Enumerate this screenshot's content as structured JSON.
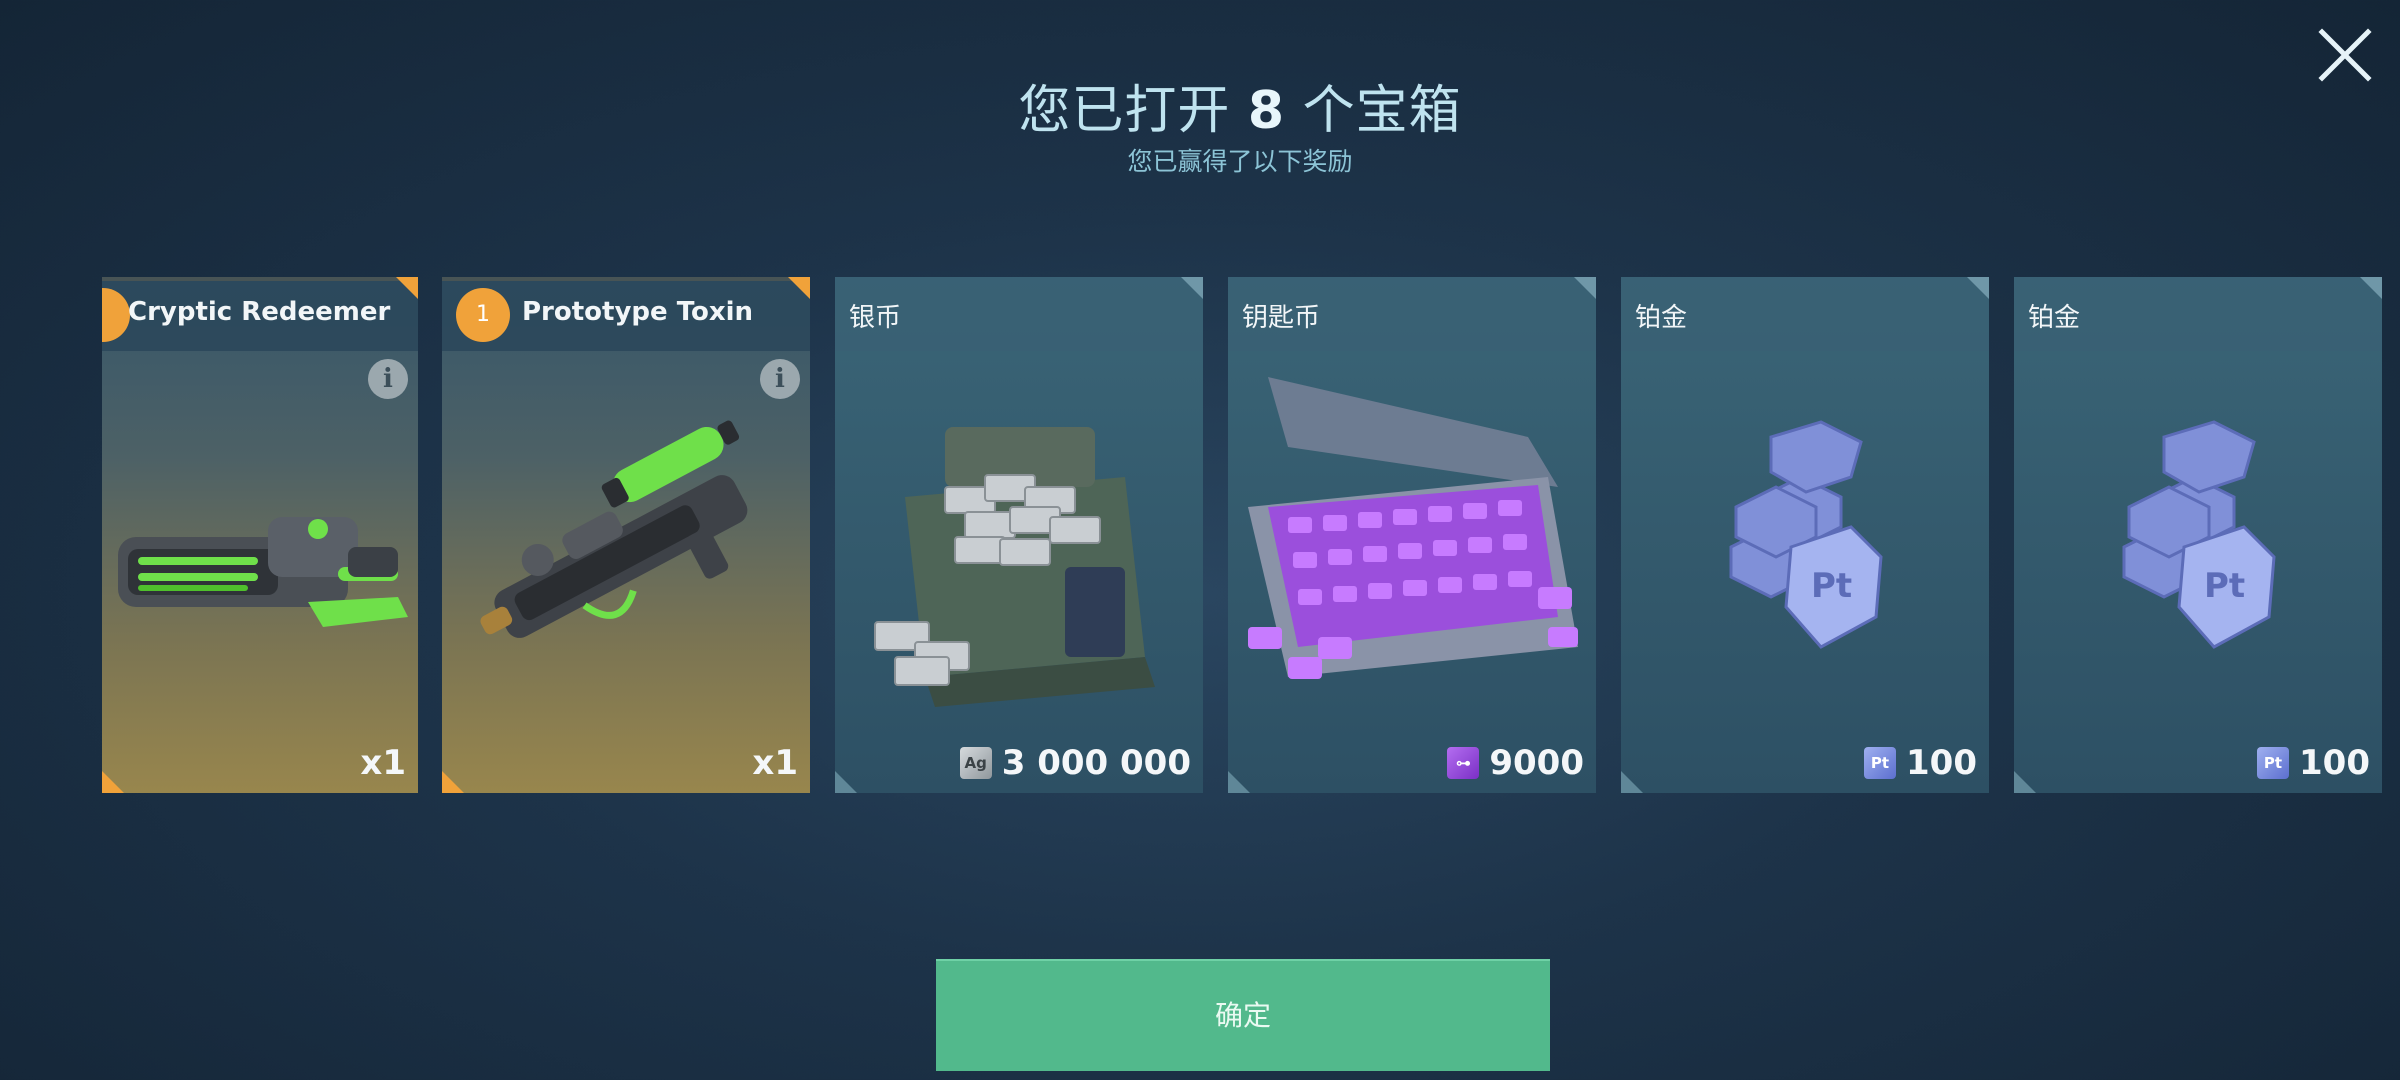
{
  "dialog": {
    "title_prefix": "您已打开",
    "chest_count": "8",
    "title_suffix": "个宝箱",
    "subtitle": "您已赢得了以下奖励",
    "close_icon": "close-icon"
  },
  "rewards": [
    {
      "name": "Cryptic Redeemer",
      "amount": "x1",
      "rarity": "legendary",
      "has_info": true
    },
    {
      "name": "Prototype Toxin",
      "level": "1",
      "amount": "x1",
      "rarity": "legendary",
      "has_info": true
    },
    {
      "name": "银币",
      "currency_icon": "silver-ag",
      "currency_label": "Ag",
      "amount": "3 000 000"
    },
    {
      "name": "钥匙币",
      "currency_icon": "key-token",
      "amount": "9000"
    },
    {
      "name": "铂金",
      "currency_icon": "platinum-pt",
      "currency_label": "Pt",
      "amount": "100"
    },
    {
      "name": "铂金",
      "currency_icon": "platinum-pt",
      "currency_label": "Pt",
      "amount": "100"
    }
  ],
  "confirm_button": {
    "label": "确定"
  },
  "colors": {
    "legendary_accent": "#f0a23a",
    "confirm_green": "#52b98c",
    "title_text": "#bfe3ef"
  }
}
